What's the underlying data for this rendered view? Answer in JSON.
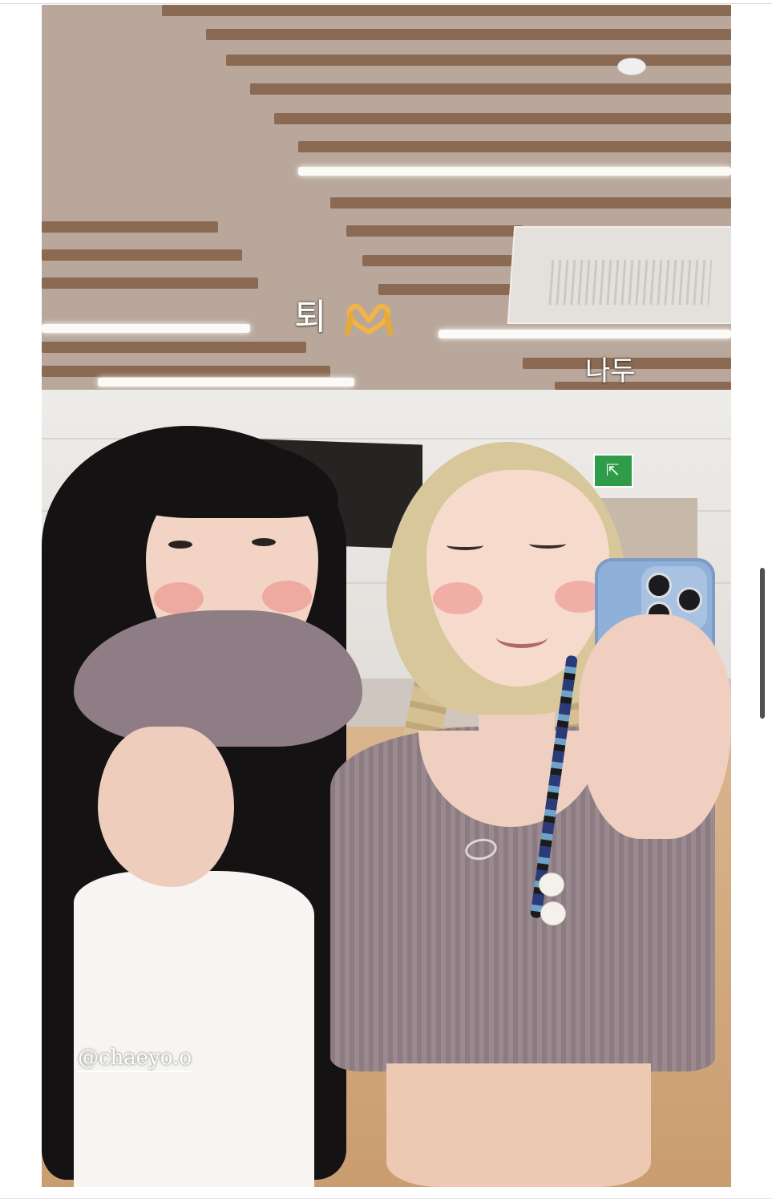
{
  "story": {
    "stickers": {
      "top_text": "퇴",
      "top_emoji": "heart-hands-emoji",
      "side_text": "나두"
    },
    "mention": "@chaeyo.o"
  },
  "icons": {
    "heart_hands": "heart-hands-icon",
    "exit": "exit-sign-icon"
  },
  "colors": {
    "overlay_text": "#ffffff",
    "scrollbar": "#505050",
    "heart_hands": "#f2b544"
  }
}
